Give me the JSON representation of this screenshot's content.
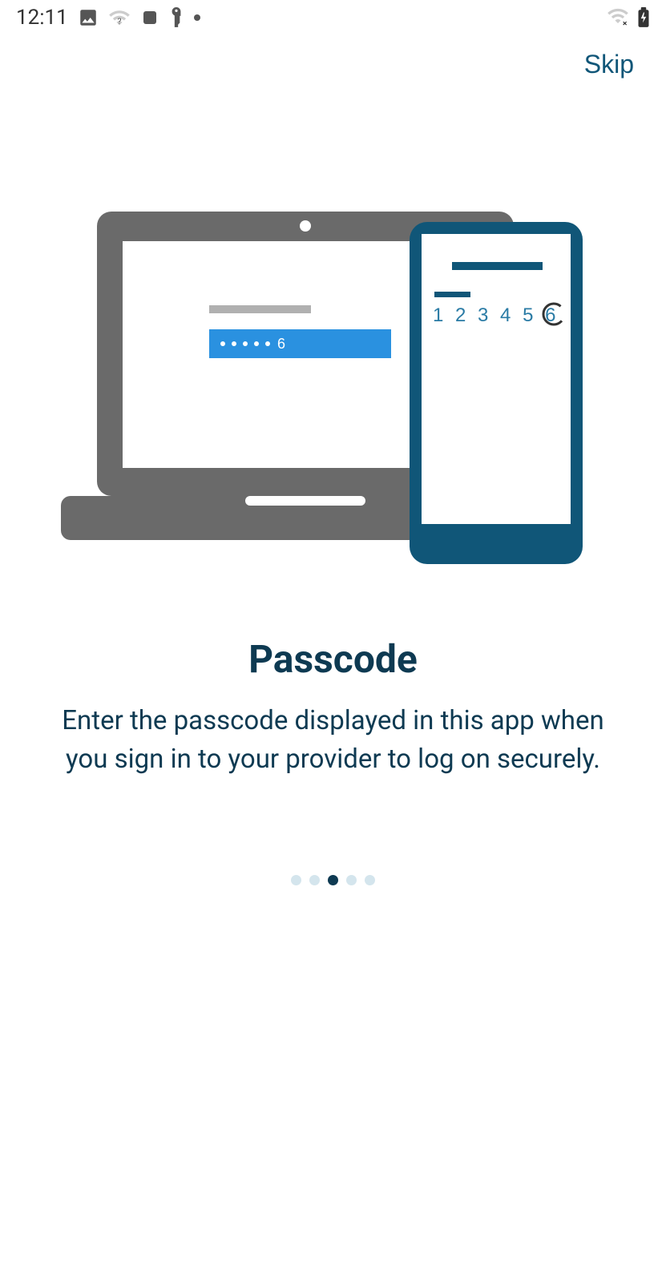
{
  "status_bar": {
    "time": "12:11"
  },
  "header": {
    "skip_label": "Skip"
  },
  "illustration": {
    "passcode_digits": "1 2 3 4 5 6",
    "password_display": "6"
  },
  "content": {
    "title": "Passcode",
    "description": "Enter the passcode displayed in this app when you sign in to your provider to log on securely."
  },
  "pagination": {
    "total_pages": 5,
    "current_page": 3
  }
}
